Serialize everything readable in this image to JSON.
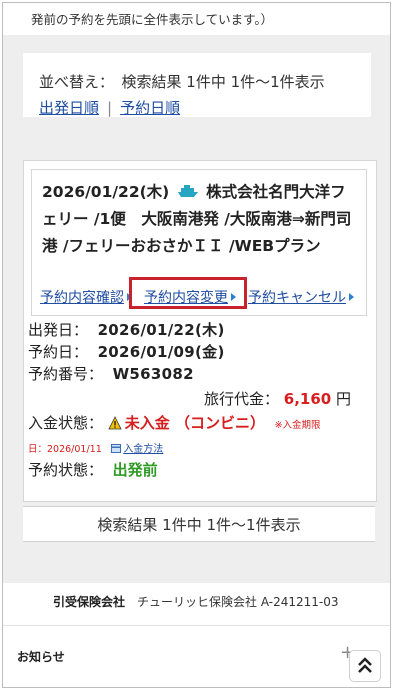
{
  "top_note": "発前の予約を先頭に全件表示しています。）",
  "sort": {
    "line": "並べ替え：　検索結果 1件中 1件〜1件表示",
    "option_departure": "出発日順",
    "separator": "|",
    "option_booking": "予約日順"
  },
  "result": {
    "title": "2026/01/22(木) 株式会社名門大洋フェリー /1便　大阪南港発 /大阪南港⇒新門司港 /フェリーおおさかＩＩ /WEBプラン",
    "title_date": "2026/01/22(木)",
    "title_rest": "株式会社名門大洋フェリー /1便　大阪南港発 /大阪南港⇒新門司港 /フェリーおおさかＩＩ /WEBプラン",
    "actions": {
      "confirm": "予約内容確認",
      "change": "予約内容変更",
      "cancel": "予約キャンセル"
    },
    "departure_label": "出発日：",
    "departure_value": "2026/01/22(木)",
    "booking_date_label": "予約日：",
    "booking_date_value": "2026/01/09(金)",
    "booking_no_label": "予約番号：",
    "booking_no_value": "W563082",
    "price_label": "旅行代金：",
    "price_value": "6,160",
    "price_unit": "円",
    "payment_label": "入金状態：",
    "payment_status": "未入金 （コンビニ）",
    "payment_deadline_note": "※入金期限",
    "deadline_date": "日：2026/01/11",
    "payment_method_link": "入金方法",
    "status_label": "予約状態：",
    "status_value": "出発前"
  },
  "summary": "検索結果 1件中 1件〜1件表示",
  "insurance": {
    "label": "引受保険会社",
    "value": "チューリッヒ保険会社 A-241211-03"
  },
  "news": {
    "label": "お知らせ",
    "toggle": "+"
  },
  "colors": {
    "link": "#1f4ea3",
    "red": "#d81e1e",
    "green": "#2f9a24",
    "highlight_border": "#c8232c",
    "ship_icon": "#27a6c4"
  },
  "icons": [
    "ship-icon",
    "warning-icon",
    "card-icon",
    "arrow-right-icon",
    "chevron-double-up-icon"
  ]
}
